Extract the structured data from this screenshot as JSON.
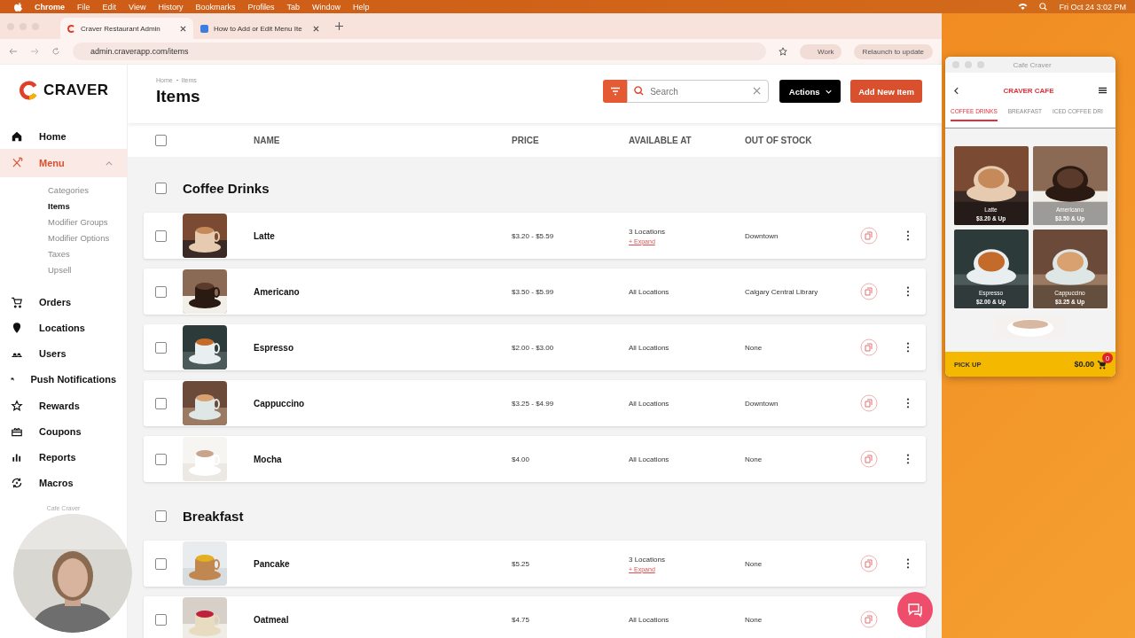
{
  "menubar": {
    "app": "Chrome",
    "menus": [
      "File",
      "Edit",
      "View",
      "History",
      "Bookmarks",
      "Profiles",
      "Tab",
      "Window",
      "Help"
    ],
    "clock": "Fri Oct 24  3:02 PM"
  },
  "browser": {
    "tabs": [
      {
        "title": "Craver Restaurant Admin",
        "selected": true
      },
      {
        "title": "How to Add or Edit Menu Ite",
        "selected": false
      }
    ],
    "url": "admin.craverapp.com/items",
    "profile": "Work",
    "relaunch": "Relaunch to update"
  },
  "sidebar": {
    "logo": "CRAVER",
    "items": [
      {
        "label": "Home",
        "selected": false
      },
      {
        "label": "Menu",
        "selected": true,
        "expanded": true,
        "children": [
          {
            "label": "Categories",
            "selected": false
          },
          {
            "label": "Items",
            "selected": true
          },
          {
            "label": "Modifier Groups",
            "selected": false
          },
          {
            "label": "Modifier Options",
            "selected": false
          },
          {
            "label": "Taxes",
            "selected": false
          },
          {
            "label": "Upsell",
            "selected": false
          }
        ]
      },
      {
        "label": "Orders",
        "selected": false
      },
      {
        "label": "Locations",
        "selected": false
      },
      {
        "label": "Users",
        "selected": false
      },
      {
        "label": "Push Notifications",
        "selected": false
      },
      {
        "label": "Rewards",
        "selected": false
      },
      {
        "label": "Coupons",
        "selected": false
      },
      {
        "label": "Reports",
        "selected": false
      },
      {
        "label": "Macros",
        "selected": false
      }
    ],
    "footer": "Cafe Craver"
  },
  "page": {
    "breadcrumb": [
      "Home",
      "Items"
    ],
    "title": "Items",
    "search": {
      "placeholder": "Search"
    },
    "actions": "Actions",
    "add_button": "Add New Item"
  },
  "table": {
    "checked": false,
    "columns": [
      "NAME",
      "PRICE",
      "AVAILABLE AT",
      "OUT OF STOCK"
    ],
    "groups": [
      {
        "name": "Coffee Drinks",
        "checked": false,
        "rows": [
          {
            "name": "Latte",
            "price": "$3.20 - $5.59",
            "available": "3 Locations",
            "expand": "+ Expand",
            "out_of_stock": "Downtown",
            "checked": false
          },
          {
            "name": "Americano",
            "price": "$3.50 - $5.99",
            "available": "All Locations",
            "out_of_stock": "Calgary Central Library",
            "checked": false
          },
          {
            "name": "Espresso",
            "price": "$2.00 - $3.00",
            "available": "All Locations",
            "out_of_stock": "None",
            "checked": false
          },
          {
            "name": "Cappuccino",
            "price": "$3.25 - $4.99",
            "available": "All Locations",
            "out_of_stock": "Downtown",
            "checked": false
          },
          {
            "name": "Mocha",
            "price": "$4.00",
            "available": "All Locations",
            "out_of_stock": "None",
            "checked": false
          }
        ]
      },
      {
        "name": "Breakfast",
        "checked": false,
        "rows": [
          {
            "name": "Pancake",
            "price": "$5.25",
            "available": "3 Locations",
            "expand": "+ Expand",
            "out_of_stock": "None",
            "checked": false
          },
          {
            "name": "Oatmeal",
            "price": "$4.75",
            "available": "All Locations",
            "out_of_stock": "None",
            "checked": false
          }
        ]
      }
    ]
  },
  "preview": {
    "title": "Cafe Craver",
    "brand": "CRAVER CAFE",
    "tabs": [
      {
        "label": "COFFEE DRINKS",
        "selected": true
      },
      {
        "label": "BREAKFAST",
        "selected": false
      },
      {
        "label": "ICED COFFEE DRI",
        "selected": false
      }
    ],
    "cards": [
      {
        "name": "Latte",
        "price": "$3.20 & Up"
      },
      {
        "name": "Americano",
        "price": "$3.50 & Up"
      },
      {
        "name": "Espresso",
        "price": "$2.00 & Up"
      },
      {
        "name": "Cappuccino",
        "price": "$3.25 & Up"
      }
    ],
    "pickup": "PICK UP",
    "total": "$0.00",
    "cart_count": "0"
  }
}
